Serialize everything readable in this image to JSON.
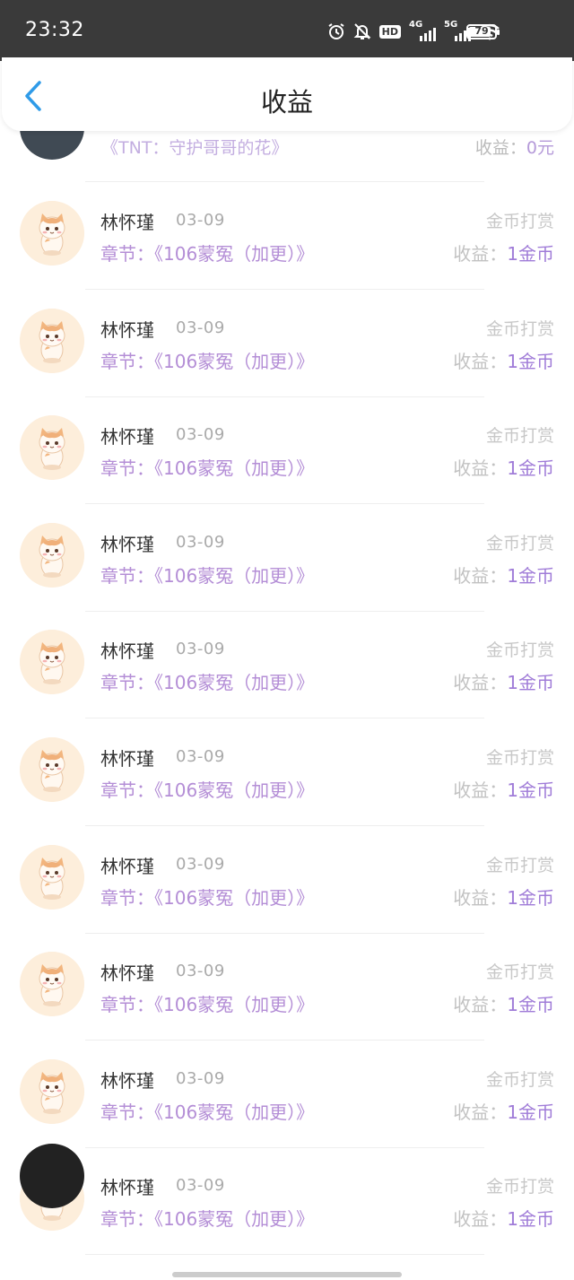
{
  "status_bar": {
    "time": "23:32",
    "hd_label": "HD",
    "net1": "4G",
    "net2": "5G",
    "battery": "79",
    "icons": [
      "alarm-icon",
      "bell-off-icon",
      "hd-icon",
      "signal-4g-icon",
      "signal-5g-icon",
      "wifi-icon",
      "battery-icon"
    ]
  },
  "header": {
    "title": "收益",
    "back_icon": "chevron-left-icon"
  },
  "partial_top": {
    "chapter": "《TNT：守护哥哥的花》",
    "earn_label": "收益：",
    "earn_value": "0元"
  },
  "rows": [
    {
      "user": "林怀瑾",
      "date": "03-09",
      "type": "金币打赏",
      "chapter": "章节：《106蒙冤（加更）》",
      "earn_label": "收益：",
      "earn_value": "1金币"
    },
    {
      "user": "林怀瑾",
      "date": "03-09",
      "type": "金币打赏",
      "chapter": "章节：《106蒙冤（加更）》",
      "earn_label": "收益：",
      "earn_value": "1金币"
    },
    {
      "user": "林怀瑾",
      "date": "03-09",
      "type": "金币打赏",
      "chapter": "章节：《106蒙冤（加更）》",
      "earn_label": "收益：",
      "earn_value": "1金币"
    },
    {
      "user": "林怀瑾",
      "date": "03-09",
      "type": "金币打赏",
      "chapter": "章节：《106蒙冤（加更）》",
      "earn_label": "收益：",
      "earn_value": "1金币"
    },
    {
      "user": "林怀瑾",
      "date": "03-09",
      "type": "金币打赏",
      "chapter": "章节：《106蒙冤（加更）》",
      "earn_label": "收益：",
      "earn_value": "1金币"
    },
    {
      "user": "林怀瑾",
      "date": "03-09",
      "type": "金币打赏",
      "chapter": "章节：《106蒙冤（加更）》",
      "earn_label": "收益：",
      "earn_value": "1金币"
    },
    {
      "user": "林怀瑾",
      "date": "03-09",
      "type": "金币打赏",
      "chapter": "章节：《106蒙冤（加更）》",
      "earn_label": "收益：",
      "earn_value": "1金币"
    },
    {
      "user": "林怀瑾",
      "date": "03-09",
      "type": "金币打赏",
      "chapter": "章节：《106蒙冤（加更）》",
      "earn_label": "收益：",
      "earn_value": "1金币"
    },
    {
      "user": "林怀瑾",
      "date": "03-09",
      "type": "金币打赏",
      "chapter": "章节：《106蒙冤（加更）》",
      "earn_label": "收益：",
      "earn_value": "1金币"
    },
    {
      "user": "林怀瑾",
      "date": "03-09",
      "type": "金币打赏",
      "chapter": "章节：《106蒙冤（加更）》",
      "earn_label": "收益：",
      "earn_value": "1金币"
    }
  ],
  "colors": {
    "status_bg": "#3a3a3a",
    "accent_purple": "#a07cd8",
    "back_blue": "#2f9be8",
    "avatar_bg": "#fdeedb"
  }
}
